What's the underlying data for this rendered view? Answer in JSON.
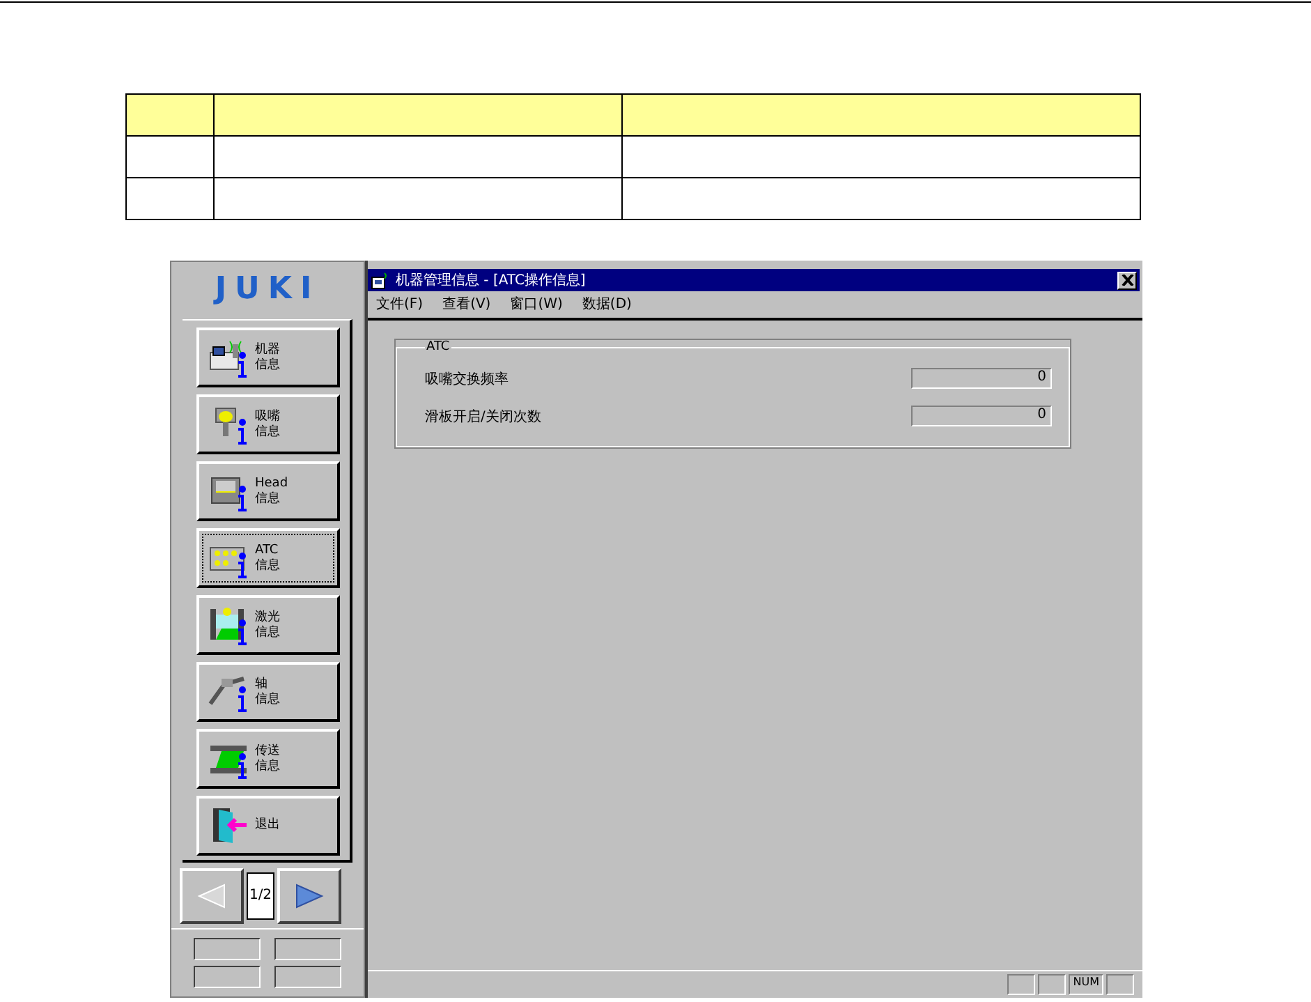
{
  "logo": "JUKI",
  "sidebar": {
    "items": [
      {
        "kind": "machine",
        "label": [
          "机器",
          "信息"
        ],
        "selected": false
      },
      {
        "kind": "nozzle",
        "label": [
          "吸嘴",
          "信息"
        ],
        "selected": false
      },
      {
        "kind": "head",
        "label": [
          "Head",
          "信息"
        ],
        "selected": false
      },
      {
        "kind": "atc",
        "label": [
          "ATC",
          "信息"
        ],
        "selected": true
      },
      {
        "kind": "laser",
        "label": [
          "激光",
          "信息"
        ],
        "selected": false
      },
      {
        "kind": "axis",
        "label": [
          "轴",
          "信息"
        ],
        "selected": false
      },
      {
        "kind": "conveyor",
        "label": [
          "传送",
          "信息"
        ],
        "selected": false
      },
      {
        "kind": "exit",
        "label": [
          "退出"
        ],
        "selected": false
      }
    ],
    "page": "1/2"
  },
  "window": {
    "title": "机器管理信息 - [ATC操作信息]",
    "menu": [
      "文件(F)",
      "查看(V)",
      "窗口(W)",
      "数据(D)"
    ],
    "group": {
      "title": "ATC",
      "fields": [
        {
          "label": "吸嘴交换频率",
          "value": "0"
        },
        {
          "label": "滑板开启/关闭次数",
          "value": "0"
        }
      ]
    },
    "status_bar": [
      {
        "kind": "blank"
      },
      {
        "kind": "blank"
      },
      {
        "kind": "indicator",
        "text": "NUM"
      },
      {
        "kind": "blank"
      }
    ]
  }
}
